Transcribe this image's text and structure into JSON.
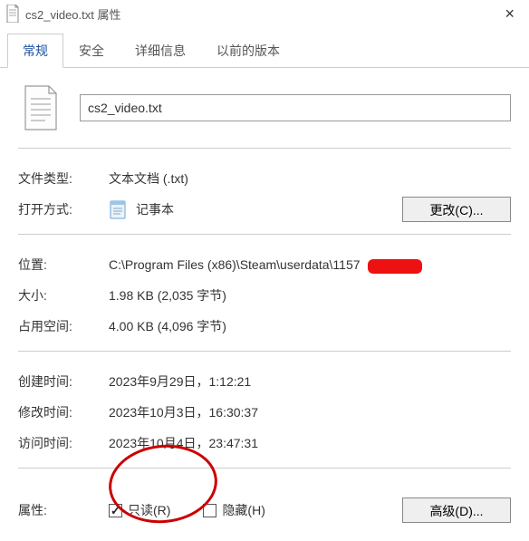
{
  "titlebar": {
    "filename": "cs2_video.txt",
    "suffix": "属性"
  },
  "tabs": [
    {
      "label": "常规",
      "active": true
    },
    {
      "label": "安全",
      "active": false
    },
    {
      "label": "详细信息",
      "active": false
    },
    {
      "label": "以前的版本",
      "active": false
    }
  ],
  "filename_field": "cs2_video.txt",
  "rows": {
    "filetype_label": "文件类型:",
    "filetype_value": "文本文档 (.txt)",
    "openwith_label": "打开方式:",
    "openwith_value": "记事本",
    "change_btn": "更改(C)...",
    "location_label": "位置:",
    "location_value": "C:\\Program Files (x86)\\Steam\\userdata\\1157",
    "size_label": "大小:",
    "size_value": "1.98 KB (2,035 字节)",
    "sizeondisk_label": "占用空间:",
    "sizeondisk_value": "4.00 KB (4,096 字节)",
    "created_label": "创建时间:",
    "created_value": "2023年9月29日，1:12:21",
    "modified_label": "修改时间:",
    "modified_value": "2023年10月3日，16:30:37",
    "accessed_label": "访问时间:",
    "accessed_value": "2023年10月4日，23:47:31",
    "attrs_label": "属性:",
    "readonly_label": "只读(R)",
    "readonly_checked": true,
    "hidden_label": "隐藏(H)",
    "hidden_checked": false,
    "advanced_btn": "高级(D)..."
  }
}
